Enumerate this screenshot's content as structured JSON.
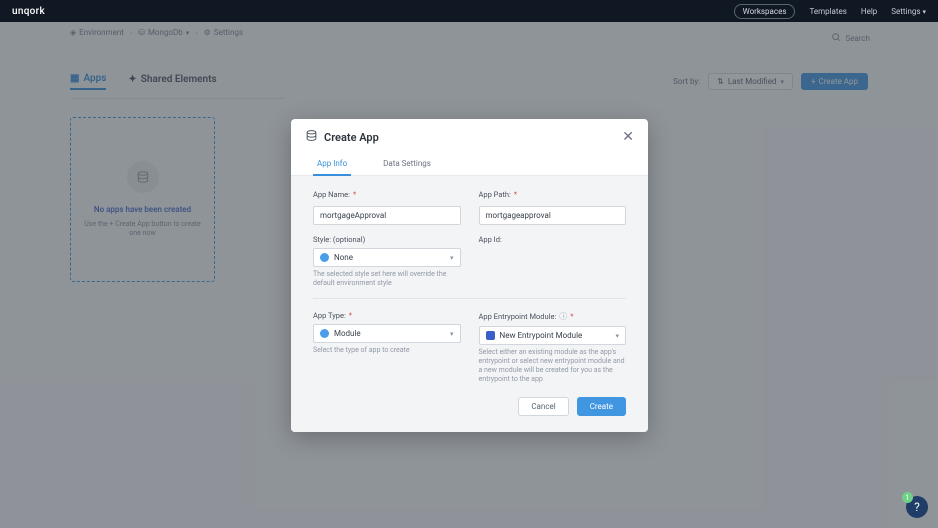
{
  "topbar": {
    "logo": "unqork",
    "workspaces": "Workspaces",
    "templates": "Templates",
    "help": "Help",
    "settings": "Settings"
  },
  "breadcrumb": {
    "item1": "Environment",
    "item2": "MongoDb",
    "item3": "Settings"
  },
  "search_label": "Search",
  "tabs": {
    "apps": "Apps",
    "shared": "Shared Elements"
  },
  "sort": {
    "label": "Sort by:",
    "value": "Last Modified"
  },
  "create_app_btn": "Create App",
  "empty": {
    "title": "No apps have been created",
    "subtitle": "Use the + Create App button to create one now"
  },
  "modal": {
    "title": "Create App",
    "tab_info": "App Info",
    "tab_data": "Data Settings",
    "app_name_label": "App Name:",
    "app_name_value": "mortgageApproval",
    "app_path_label": "App Path:",
    "app_path_value": "mortgageapproval",
    "style_label": "Style: (optional)",
    "style_value": "None",
    "style_helper": "The selected style set here will override the default environment style",
    "app_id_label": "App Id:",
    "app_type_label": "App Type:",
    "app_type_value": "Module",
    "app_type_helper": "Select the type of app to create",
    "entry_label": "App Entrypoint Module:",
    "entry_value": "New Entrypoint Module",
    "entry_helper": "Select either an existing module as the app's entrypoint or select new entrypoint module and a new module will be created for you as the entrypoint to the app",
    "cancel": "Cancel",
    "create": "Create"
  },
  "help_count": "1",
  "colors": {
    "style_icon": "#4a9de8",
    "type_icon": "#4a9de8",
    "entry_icon": "#3a5fc9"
  }
}
